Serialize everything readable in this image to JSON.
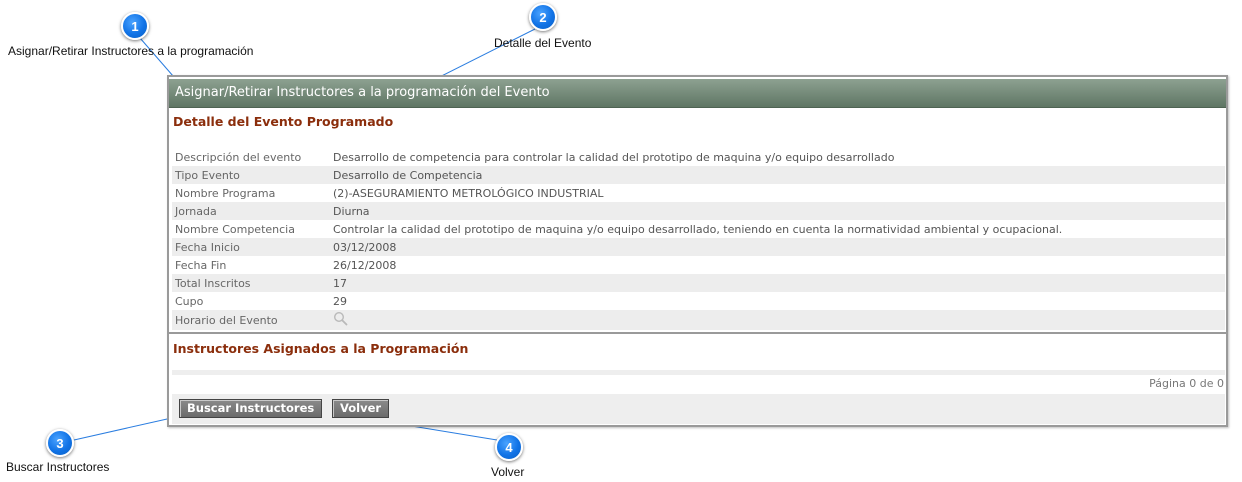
{
  "annotations": [
    {
      "num": "1",
      "label": "Asignar/Retirar Instructores a la programación"
    },
    {
      "num": "2",
      "label": "Detalle del Evento"
    },
    {
      "num": "3",
      "label": "Buscar Instructores"
    },
    {
      "num": "4",
      "label": "Volver"
    }
  ],
  "panel": {
    "title": "Asignar/Retirar Instructores a la programación del Evento",
    "detail_title": "Detalle del Evento Programado",
    "rows": [
      {
        "label": "Descripción del evento",
        "value": "Desarrollo de competencia para controlar la calidad del prototipo de maquina y/o equipo desarrollado"
      },
      {
        "label": "Tipo Evento",
        "value": "Desarrollo de Competencia"
      },
      {
        "label": "Nombre Programa",
        "value": "(2)-ASEGURAMIENTO METROLÓGICO INDUSTRIAL"
      },
      {
        "label": "Jornada",
        "value": "Diurna"
      },
      {
        "label": "Nombre Competencia",
        "value": "Controlar la calidad del prototipo de maquina y/o equipo desarrollado, teniendo en cuenta la normatividad ambiental y ocupacional."
      },
      {
        "label": "Fecha Inicio",
        "value": "03/12/2008"
      },
      {
        "label": "Fecha Fin",
        "value": "26/12/2008"
      },
      {
        "label": "Total Inscritos",
        "value": "17"
      },
      {
        "label": "Cupo",
        "value": "29"
      },
      {
        "label": "Horario del Evento",
        "icon": "search-icon"
      }
    ],
    "instructors_title": "Instructores Asignados a la Programación",
    "pager": "Página 0 de 0",
    "buttons": {
      "search": "Buscar Instructores",
      "back": "Volver"
    }
  }
}
